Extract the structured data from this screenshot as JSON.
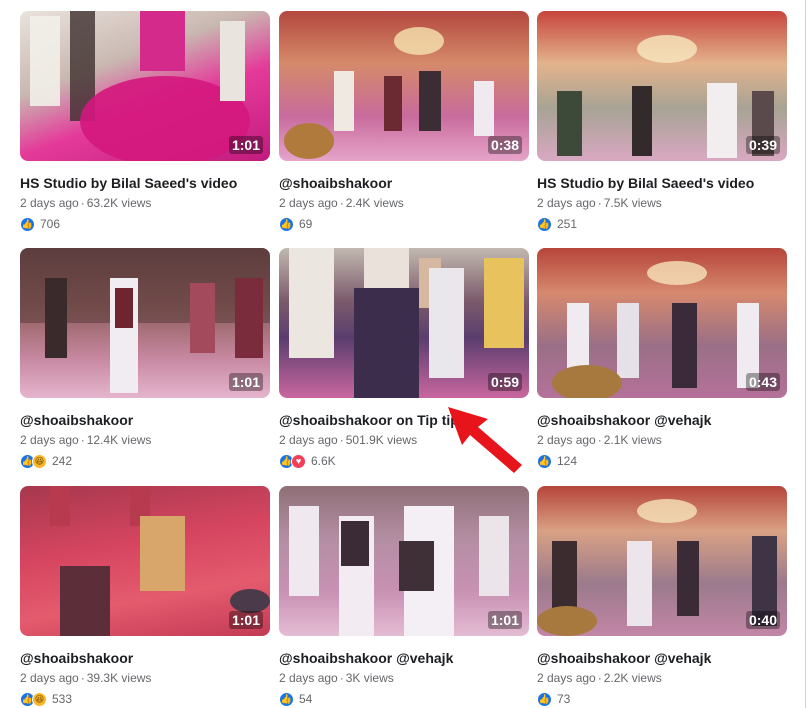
{
  "videos": [
    {
      "title": "HS Studio by Bilal Saeed's video",
      "age": "2 days ago",
      "views": "63.2K views",
      "duration": "1:01",
      "reactions": [
        "like"
      ],
      "count": "706",
      "bg": "linear-gradient(160deg,#e9e3dc 0%,#c9b8b1 35%,#e43b9a 60%,#c11b7e 100%)"
    },
    {
      "title": "@shoaibshakoor",
      "age": "2 days ago",
      "views": "2.4K views",
      "duration": "0:38",
      "reactions": [
        "like"
      ],
      "count": "69",
      "bg": "linear-gradient(180deg,#b3483f 0%,#d58a6a 35%,#c86b9c 70%,#e6a4c9 100%)"
    },
    {
      "title": "HS Studio by Bilal Saeed's video",
      "age": "2 days ago",
      "views": "7.5K views",
      "duration": "0:39",
      "reactions": [
        "like"
      ],
      "count": "251",
      "bg": "linear-gradient(180deg,#c6453d 0%,#e3b38c 35%,#a7a394 65%,#d9a8c2 100%)"
    },
    {
      "title": "@shoaibshakoor",
      "age": "2 days ago",
      "views": "12.4K views",
      "duration": "1:01",
      "reactions": [
        "like",
        "haha"
      ],
      "count": "242",
      "bg": "linear-gradient(180deg,#5a3b3d 0%,#8f5e5c 40%,#c98aa4 75%,#e5b5cd 100%)"
    },
    {
      "title": "@shoaibshakoor on Tip tip",
      "age": "2 days ago",
      "views": "501.9K views",
      "duration": "0:59",
      "reactions": [
        "like",
        "love"
      ],
      "count": "6.6K",
      "bg": "linear-gradient(180deg,#c2b9b0 0%,#7c5b6c 35%,#5a3d6e 60%,#c9679f 100%)"
    },
    {
      "title": "@shoaibshakoor @vehajk",
      "age": "2 days ago",
      "views": "2.1K views",
      "duration": "0:43",
      "reactions": [
        "like"
      ],
      "count": "124",
      "bg": "linear-gradient(180deg,#b6453a 0%,#d6896e 30%,#9a6f86 65%,#b5719a 100%)"
    },
    {
      "title": "@shoaibshakoor",
      "age": "2 days ago",
      "views": "39.3K views",
      "duration": "1:01",
      "reactions": [
        "like",
        "haha"
      ],
      "count": "533",
      "bg": "linear-gradient(170deg,#a6384e 0%,#d64560 40%,#e45b6e 70%,#c33a55 100%)"
    },
    {
      "title": "@shoaibshakoor @vehajk",
      "age": "2 days ago",
      "views": "3K views",
      "duration": "1:01",
      "reactions": [
        "like"
      ],
      "count": "54",
      "bg": "linear-gradient(180deg,#8f6f76 0%,#b38ea3 35%,#c891b3 70%,#e4bcd3 100%)"
    },
    {
      "title": "@shoaibshakoor @vehajk",
      "age": "2 days ago",
      "views": "2.2K views",
      "duration": "0:40",
      "reactions": [
        "like"
      ],
      "count": "73",
      "bg": "linear-gradient(180deg,#b6453a 0%,#d9a184 30%,#9b7a8c 65%,#c286a6 100%)"
    }
  ],
  "colors": {
    "like": "#1b74e4",
    "love": "#f33e58",
    "haha": "#f7b928",
    "arrow": "#e8141c"
  },
  "icons": {
    "like": "thumbs-up-icon",
    "love": "heart-icon",
    "haha": "laughing-face-icon",
    "arrow": "red-pointer-arrow"
  }
}
